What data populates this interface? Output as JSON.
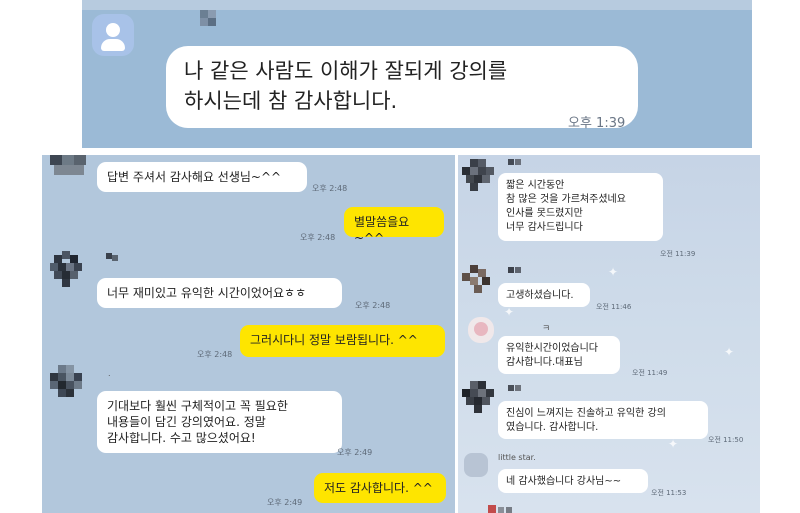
{
  "top_chat": {
    "message": "나 같은 사람도 이해가 잘되게 강의를\n하시는데 참 감사합니다.",
    "time": "오후 1:39"
  },
  "left_chat": {
    "messages": [
      {
        "text": "답변 주셔서 감사해요 선생님~^^",
        "time": "오후 2:48"
      },
      {
        "text": "별말씀을요~^^",
        "time": "오후 2:48"
      },
      {
        "text": "너무 재미있고 유익한 시간이었어요ㅎㅎ",
        "time": "오후 2:48"
      },
      {
        "text": "그러시다니 정말 보람됩니다. ^^",
        "time": "오후 2:48"
      },
      {
        "text": "기대보다 훨씬 구체적이고 꼭 필요한\n내용들이 담긴 강의였어요. 정말\n감사합니다. 수고 많으셨어요!",
        "time": "오후 2:49"
      },
      {
        "text": "저도 감사합니다. ^^",
        "time": "오후 2:49"
      }
    ]
  },
  "right_chat": {
    "messages": [
      {
        "text": "짧은 시간동안\n참 많은 것을 가르쳐주셨네요\n인사를 못드렸지만\n너무 감사드립니다",
        "time": "오전 11:39"
      },
      {
        "text": "고생하셨습니다.",
        "time": "오전 11:46"
      },
      {
        "text": "유익한시간이었습니다\n감사합니다.대표님",
        "time": "오전 11:49"
      },
      {
        "text": "진심이 느껴지는 진솔하고 유익한 강의\n였습니다. 감사합니다.",
        "time": "오전 11:50"
      },
      {
        "text": "네 감사했습니다 강사님~~",
        "time": "오전 11:53"
      }
    ],
    "sender_little_star": "little star.",
    "sender_j": "ㅋ"
  }
}
